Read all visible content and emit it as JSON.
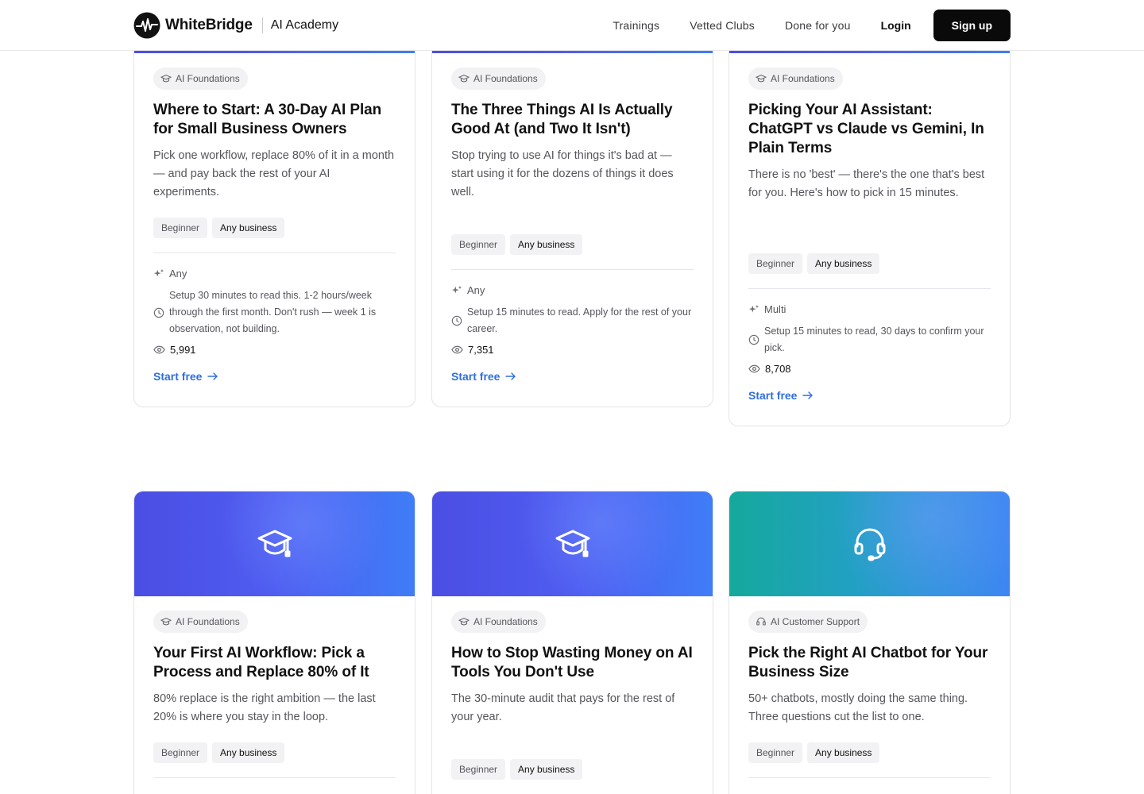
{
  "brand": {
    "name": "WhiteBridge",
    "product": "AI Academy"
  },
  "nav": {
    "links": [
      "Trainings",
      "Vetted Clubs",
      "Done for you"
    ],
    "login": "Login",
    "signup": "Sign up"
  },
  "cards": [
    {
      "category": "AI Foundations",
      "title": "Where to Start: A 30-Day AI Plan for Small Business Owners",
      "description": "Pick one workflow, replace 80% of it in a month — and pay back the rest of your AI experiments.",
      "tags": [
        "Beginner",
        "Any business"
      ],
      "ai_type": "Any",
      "setup": "Setup 30 minutes to read this. 1-2 hours/week through the first month. Don't rush — week 1 is observation, not building.",
      "views": "5,991",
      "cta": "Start free"
    },
    {
      "category": "AI Foundations",
      "title": "The Three Things AI Is Actually Good At (and Two It Isn't)",
      "description": "Stop trying to use AI for things it's bad at — start using it for the dozens of things it does well.",
      "tags": [
        "Beginner",
        "Any business"
      ],
      "ai_type": "Any",
      "setup": "Setup 15 minutes to read. Apply for the rest of your career.",
      "views": "7,351",
      "cta": "Start free"
    },
    {
      "category": "AI Foundations",
      "title": "Picking Your AI Assistant: ChatGPT vs Claude vs Gemini, In Plain Terms",
      "description": "There is no 'best' — there's the one that's best for you. Here's how to pick in 15 minutes.",
      "tags": [
        "Beginner",
        "Any business"
      ],
      "ai_type": "Multi",
      "setup": "Setup 15 minutes to read, 30 days to confirm your pick.",
      "views": "8,708",
      "cta": "Start free"
    },
    {
      "category": "AI Foundations",
      "title": "Your First AI Workflow: Pick a Process and Replace 80% of It",
      "description": "80% replace is the right ambition — the last 20% is where you stay in the loop.",
      "tags": [
        "Beginner",
        "Any business"
      ]
    },
    {
      "category": "AI Foundations",
      "title": "How to Stop Wasting Money on AI Tools You Don't Use",
      "description": "The 30-minute audit that pays for the rest of your year.",
      "tags": [
        "Beginner",
        "Any business"
      ]
    },
    {
      "category": "AI Customer Support",
      "title": "Pick the Right AI Chatbot for Your Business Size",
      "description": "50+ chatbots, mostly doing the same thing. Three questions cut the list to one.",
      "tags": [
        "Beginner",
        "Any business"
      ]
    }
  ]
}
